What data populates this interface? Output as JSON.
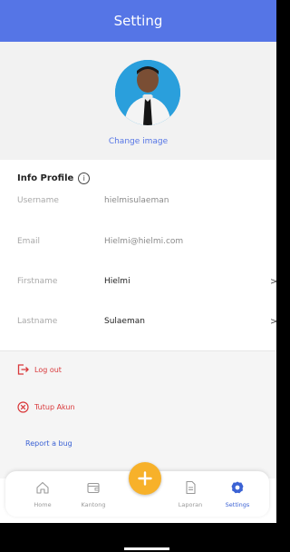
{
  "header": {
    "title": "Setting"
  },
  "profile": {
    "change_image_label": "Change image"
  },
  "info": {
    "title": "Info Profile",
    "info_glyph": "i",
    "rows": [
      {
        "label": "Username",
        "value": "hielmisulaeman"
      },
      {
        "label": "Email",
        "value": "Hielmi@hielmi.com"
      },
      {
        "label": "Firstname",
        "value": "Hielmi",
        "chevron": ">"
      },
      {
        "label": "Lastname",
        "value": "Sulaeman",
        "chevron": ">"
      }
    ]
  },
  "actions": {
    "logout": "Log out",
    "close_account": "Tutup Akun",
    "report_bug": "Report a bug"
  },
  "nav": {
    "items": [
      {
        "label": "Home",
        "icon": "home-icon"
      },
      {
        "label": "Kantong",
        "icon": "wallet-icon"
      },
      {
        "label": "Laporan",
        "icon": "document-icon"
      },
      {
        "label": "Settings",
        "icon": "settings-icon",
        "active": true
      }
    ],
    "fab_symbol": "+"
  },
  "colors": {
    "primary": "#5575e6",
    "danger": "#d9383a",
    "fab": "#f7b12a",
    "link": "#3b62d4"
  }
}
